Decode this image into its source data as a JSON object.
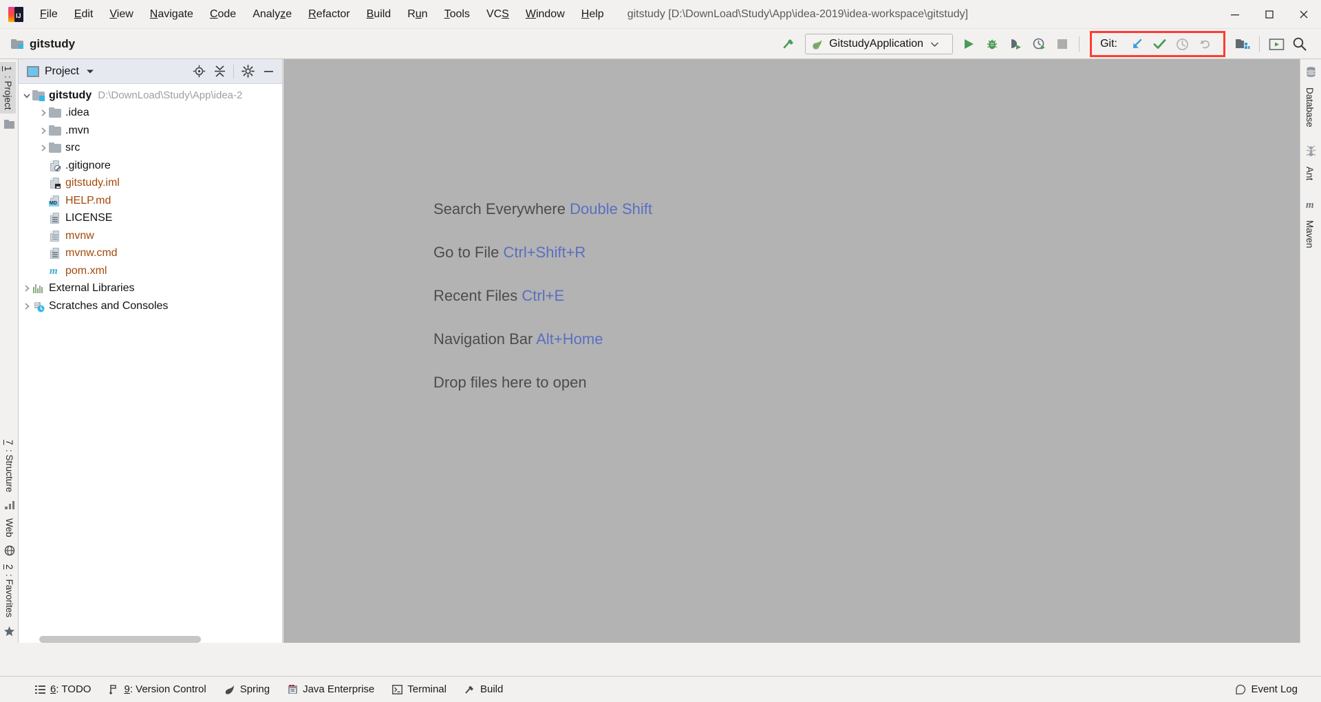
{
  "window": {
    "title": "gitstudy [D:\\DownLoad\\Study\\App\\idea-2019\\idea-workspace\\gitstudy]",
    "minimize_label": "─",
    "maximize_label": "❐",
    "close_label": "✕"
  },
  "menubar": {
    "items": [
      {
        "mnemonic": "F",
        "rest": "ile"
      },
      {
        "mnemonic": "E",
        "rest": "dit"
      },
      {
        "mnemonic": "V",
        "rest": "iew"
      },
      {
        "mnemonic": "N",
        "rest": "avigate"
      },
      {
        "mnemonic": "C",
        "rest": "ode"
      },
      {
        "mnemonic": "Analy",
        "rest": "ze",
        "pre": true
      },
      {
        "mnemonic": "R",
        "rest": "efactor"
      },
      {
        "mnemonic": "B",
        "rest": "uild"
      },
      {
        "mnemonic": "R",
        "rest": "un",
        "split": "u"
      },
      {
        "mnemonic": "T",
        "rest": "ools"
      },
      {
        "mnemonic": "VCS",
        "rest": ""
      },
      {
        "mnemonic": "W",
        "rest": "indow"
      },
      {
        "mnemonic": "H",
        "rest": "elp"
      }
    ],
    "labels": [
      "File",
      "Edit",
      "View",
      "Navigate",
      "Code",
      "Analyze",
      "Refactor",
      "Build",
      "Run",
      "Tools",
      "VCS",
      "Window",
      "Help"
    ]
  },
  "toolbar": {
    "project_name": "gitstudy",
    "run_config": "GitstudyApplication",
    "run_config_chevron": "⌄",
    "git_label": "Git:",
    "buttons": {
      "build": "build-hammer",
      "run": "run",
      "debug": "debug",
      "run_coverage": "run-with-coverage",
      "profiler": "profiler",
      "stop": "stop",
      "git_update": "update-project",
      "git_commit": "commit",
      "git_history": "show-history",
      "git_rollback": "rollback",
      "project_structure": "project-structure",
      "settings_presentation": "presentation-mode",
      "search": "search-everywhere"
    },
    "accent_red": "#ff3b30",
    "accent_green": "#499c54",
    "accent_blue": "#389fd6"
  },
  "project_panel": {
    "title": "Project",
    "title_chevron": "▾",
    "actions": [
      "locate-icon",
      "collapse-all-icon",
      "settings-gear-icon",
      "hide-icon"
    ],
    "tree": [
      {
        "indent": 0,
        "arrow": "˅",
        "icon": "module-folder",
        "label": "gitstudy",
        "bold": true,
        "color": "black",
        "path": "D:\\DownLoad\\Study\\App\\idea-2"
      },
      {
        "indent": 1,
        "arrow": "›",
        "icon": "folder",
        "label": ".idea",
        "color": "black"
      },
      {
        "indent": 1,
        "arrow": "›",
        "icon": "folder",
        "label": ".mvn",
        "color": "black"
      },
      {
        "indent": 1,
        "arrow": "›",
        "icon": "folder",
        "label": "src",
        "color": "black"
      },
      {
        "indent": 1,
        "arrow": "",
        "icon": "file-ignored",
        "label": ".gitignore",
        "color": "black"
      },
      {
        "indent": 1,
        "arrow": "",
        "icon": "file-iml",
        "label": "gitstudy.iml",
        "color": "brown"
      },
      {
        "indent": 1,
        "arrow": "",
        "icon": "file-md",
        "label": "HELP.md",
        "color": "brown"
      },
      {
        "indent": 1,
        "arrow": "",
        "icon": "file-text",
        "label": "LICENSE",
        "color": "black"
      },
      {
        "indent": 1,
        "arrow": "",
        "icon": "file-text",
        "label": "mvnw",
        "color": "brown"
      },
      {
        "indent": 1,
        "arrow": "",
        "icon": "file-text",
        "label": "mvnw.cmd",
        "color": "brown"
      },
      {
        "indent": 1,
        "arrow": "",
        "icon": "maven-m",
        "label": "pom.xml",
        "color": "brown"
      },
      {
        "indent": 0,
        "arrow": "›",
        "icon": "libraries",
        "label": "External Libraries",
        "color": "black"
      },
      {
        "indent": 0,
        "arrow": "›",
        "icon": "scratches",
        "label": "Scratches and Consoles",
        "color": "black"
      }
    ]
  },
  "left_stripe": {
    "top_items": [
      {
        "num": "1",
        "label": ": Project",
        "selected": true
      }
    ],
    "bottom_items": [
      {
        "num": "7",
        "label": ": Structure"
      },
      {
        "num": "",
        "label": "Web"
      },
      {
        "num": "2",
        "label": ": Favorites"
      }
    ]
  },
  "right_stripe": {
    "items": [
      {
        "label": "Database",
        "icon": "database-icon"
      },
      {
        "label": "Ant",
        "icon": "ant-icon"
      },
      {
        "label": "Maven",
        "icon": "maven-icon"
      }
    ]
  },
  "editor": {
    "hints": [
      {
        "action": "Search Everywhere",
        "shortcut": "Double Shift"
      },
      {
        "action": "Go to File",
        "shortcut": "Ctrl+Shift+R"
      },
      {
        "action": "Recent Files",
        "shortcut": "Ctrl+E"
      },
      {
        "action": "Navigation Bar",
        "shortcut": "Alt+Home"
      },
      {
        "action": "Drop files here to open",
        "shortcut": ""
      }
    ]
  },
  "statusbar": {
    "items": [
      {
        "num": "6",
        "label": ": TODO",
        "icon": "todo-icon"
      },
      {
        "num": "9",
        "label": ": Version Control",
        "icon": "version-control-icon"
      },
      {
        "num": "",
        "label": "Spring",
        "icon": "spring-icon"
      },
      {
        "num": "",
        "label": "Java Enterprise",
        "icon": "java-enterprise-icon"
      },
      {
        "num": "",
        "label": "Terminal",
        "icon": "terminal-icon"
      },
      {
        "num": "",
        "label": "Build",
        "icon": "build-icon"
      }
    ],
    "event_log": "Event Log"
  }
}
